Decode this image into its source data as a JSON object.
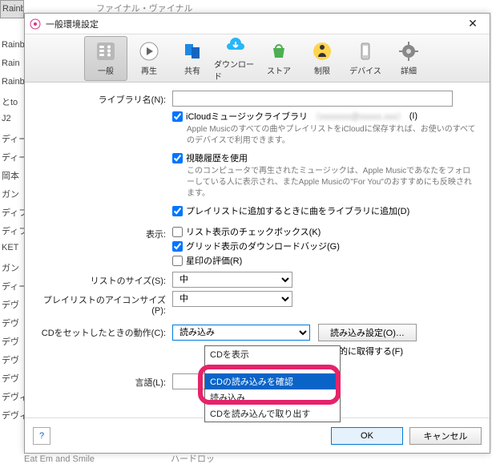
{
  "bg": {
    "rows": [
      "Rainbow",
      "",
      "Rainb",
      "Rain",
      "Rainb",
      "とto",
      "J2",
      "ディー",
      "ディー",
      "岡本",
      "ガン",
      "ディフ",
      "ディフ",
      "KET",
      "ガン",
      "ディー",
      "デヴ",
      "デヴ",
      "デヴ",
      "デヴ",
      "デヴ",
      "デヴィッド",
      "デヴィッド・リー・ロス"
    ],
    "topTitle": "ファイナル・ヴァイナル",
    "bottomArtist1": "Eat Em and Smile",
    "bottomArtist2": "ハードロッ"
  },
  "title": "一般環境設定",
  "tabs": [
    {
      "label": "一般",
      "name": "general"
    },
    {
      "label": "再生",
      "name": "playback"
    },
    {
      "label": "共有",
      "name": "sharing"
    },
    {
      "label": "ダウンロード",
      "name": "downloads"
    },
    {
      "label": "ストア",
      "name": "store"
    },
    {
      "label": "制限",
      "name": "restrictions"
    },
    {
      "label": "デバイス",
      "name": "devices"
    },
    {
      "label": "詳細",
      "name": "advanced"
    }
  ],
  "form": {
    "libNameLabel": "ライブラリ名(N):",
    "libNameValue": "",
    "icloudLabel": "iCloudミュージックライブラリ",
    "icloudSuffix": "(I)",
    "icloudDesc": "Apple Musicのすべての曲やプレイリストをiCloudに保存すれば、お使いのすべてのデバイスで利用できます。",
    "historyLabel": "視聴履歴を使用",
    "historyDesc": "このコンピュータで再生されたミュージックは、Apple Musicであなたをフォローしている人に表示され、またApple Musicの\"For You\"のおすすめにも反映されます。",
    "addPlaylistLabel": "プレイリストに追加するときに曲をライブラリに追加(D)",
    "displayLabel": "表示:",
    "listCheckLabel": "リスト表示のチェックボックス(K)",
    "gridBadgeLabel": "グリッド表示のダウンロードバッジ(G)",
    "starRatingLabel": "星印の評価(R)",
    "listSizeLabel": "リストのサイズ(S):",
    "listSizeValue": "中",
    "playlistIconLabel": "プレイリストのアイコンサイズ(P):",
    "playlistIconValue": "中",
    "cdActionLabel": "CDをセットしたときの動作(C):",
    "cdActionValue": "読み込み",
    "importSettingsBtn": "読み込み設定(O)…",
    "autoFetchLabel": "動的に取得する(F)",
    "languageLabel": "言語(L):",
    "languageValue": ""
  },
  "dropdown": {
    "options": [
      "CDを表示",
      "",
      "CDの読み込みを確認",
      "読み込み",
      "CDを読み込んで取り出す"
    ]
  },
  "footer": {
    "help": "?",
    "ok": "OK",
    "cancel": "キャンセル"
  }
}
